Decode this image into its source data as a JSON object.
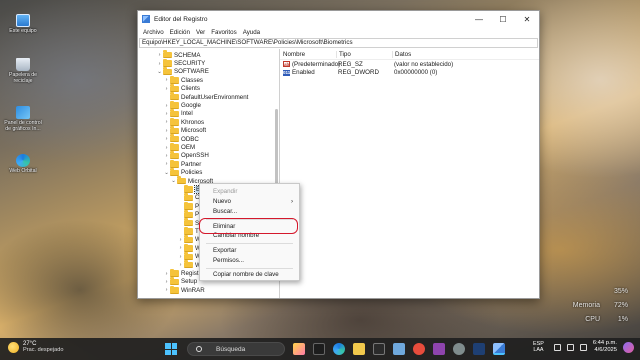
{
  "desktop": {
    "icons": [
      {
        "label": "Este equipo",
        "icon": "computer-icon"
      },
      {
        "label": "Papelera de reciclaje",
        "icon": "recycle-bin-icon"
      },
      {
        "label": "Panel de control de gráficos In...",
        "icon": "graphics-control-panel-icon"
      },
      {
        "label": "Web Orbital",
        "icon": "browser-icon"
      }
    ],
    "perf": {
      "v1": "35%",
      "memoria_label": "Memoria",
      "v2": "72%",
      "cpu_label": "CPU",
      "v3": "1%"
    }
  },
  "window": {
    "title": "Editor del Registro",
    "controls": {
      "minimize": "—",
      "maximize": "☐",
      "close": "✕"
    },
    "menu": [
      "Archivo",
      "Edición",
      "Ver",
      "Favoritos",
      "Ayuda"
    ],
    "address": "Equipo\\HKEY_LOCAL_MACHINE\\SOFTWARE\\Policies\\Microsoft\\Biometrics",
    "tree": [
      {
        "label": "SCHEMA",
        "chevron": "›",
        "indent": 0
      },
      {
        "label": "SECURITY",
        "chevron": "›",
        "indent": 0
      },
      {
        "label": "SOFTWARE",
        "chevron": "⌄",
        "indent": 0
      },
      {
        "label": "Classes",
        "chevron": "›",
        "indent": 1
      },
      {
        "label": "Clients",
        "chevron": "›",
        "indent": 1
      },
      {
        "label": "DefaultUserEnvironment",
        "chevron": "",
        "indent": 1
      },
      {
        "label": "Google",
        "chevron": "›",
        "indent": 1
      },
      {
        "label": "Intel",
        "chevron": "›",
        "indent": 1
      },
      {
        "label": "Khronos",
        "chevron": "›",
        "indent": 1
      },
      {
        "label": "Microsoft",
        "chevron": "›",
        "indent": 1
      },
      {
        "label": "ODBC",
        "chevron": "›",
        "indent": 1
      },
      {
        "label": "OEM",
        "chevron": "›",
        "indent": 1
      },
      {
        "label": "OpenSSH",
        "chevron": "›",
        "indent": 1
      },
      {
        "label": "Partner",
        "chevron": "›",
        "indent": 1
      },
      {
        "label": "Policies",
        "chevron": "⌄",
        "indent": 1
      },
      {
        "label": "Microsoft",
        "chevron": "⌄",
        "indent": 2
      },
      {
        "label": "Biometrics",
        "chevron": "",
        "indent": 3,
        "selected": true
      },
      {
        "label": "C",
        "chevron": "",
        "indent": 3
      },
      {
        "label": "P",
        "chevron": "",
        "indent": 3
      },
      {
        "label": "P",
        "chevron": "",
        "indent": 3
      },
      {
        "label": "S",
        "chevron": "",
        "indent": 3
      },
      {
        "label": "T",
        "chevron": "",
        "indent": 3
      },
      {
        "label": "W",
        "chevron": "›",
        "indent": 3
      },
      {
        "label": "W",
        "chevron": "›",
        "indent": 3
      },
      {
        "label": "W",
        "chevron": "›",
        "indent": 3
      },
      {
        "label": "W",
        "chevron": "›",
        "indent": 3
      },
      {
        "label": "Regist",
        "chevron": "›",
        "indent": 1
      },
      {
        "label": "Setup",
        "chevron": "›",
        "indent": 1
      },
      {
        "label": "WinRAR",
        "chevron": "›",
        "indent": 1
      }
    ],
    "columns": {
      "name": "Nombre",
      "type": "Tipo",
      "data": "Datos"
    },
    "values": [
      {
        "name": "(Predeterminado)",
        "type": "REG_SZ",
        "data": "(valor no establecido)",
        "icon": "ab"
      },
      {
        "name": "Enabled",
        "type": "REG_DWORD",
        "data": "0x00000000 (0)",
        "icon": "011"
      }
    ]
  },
  "context_menu": {
    "items": [
      {
        "label": "Expandir",
        "disabled": true,
        "arrow": ""
      },
      {
        "label": "Nuevo",
        "disabled": false,
        "arrow": "›"
      },
      {
        "label": "Buscar...",
        "disabled": false,
        "arrow": ""
      },
      {
        "label": "Eliminar",
        "disabled": false,
        "arrow": "",
        "highlighted": true
      },
      {
        "label": "Cambiar nombre",
        "disabled": false,
        "arrow": ""
      },
      {
        "label": "Exportar",
        "disabled": false,
        "arrow": ""
      },
      {
        "label": "Permisos...",
        "disabled": false,
        "arrow": ""
      },
      {
        "label": "Copiar nombre de clave",
        "disabled": false,
        "arrow": ""
      }
    ],
    "highlight_color": "#d4182c"
  },
  "taskbar": {
    "weather": {
      "temp": "27°C",
      "desc": "Prac. despejado"
    },
    "search_placeholder": "Búsqueda",
    "lang": {
      "line1": "ESP",
      "line2": "LAA"
    },
    "clock": {
      "time": "6:44 p.m.",
      "date": "4/6/2025"
    }
  }
}
